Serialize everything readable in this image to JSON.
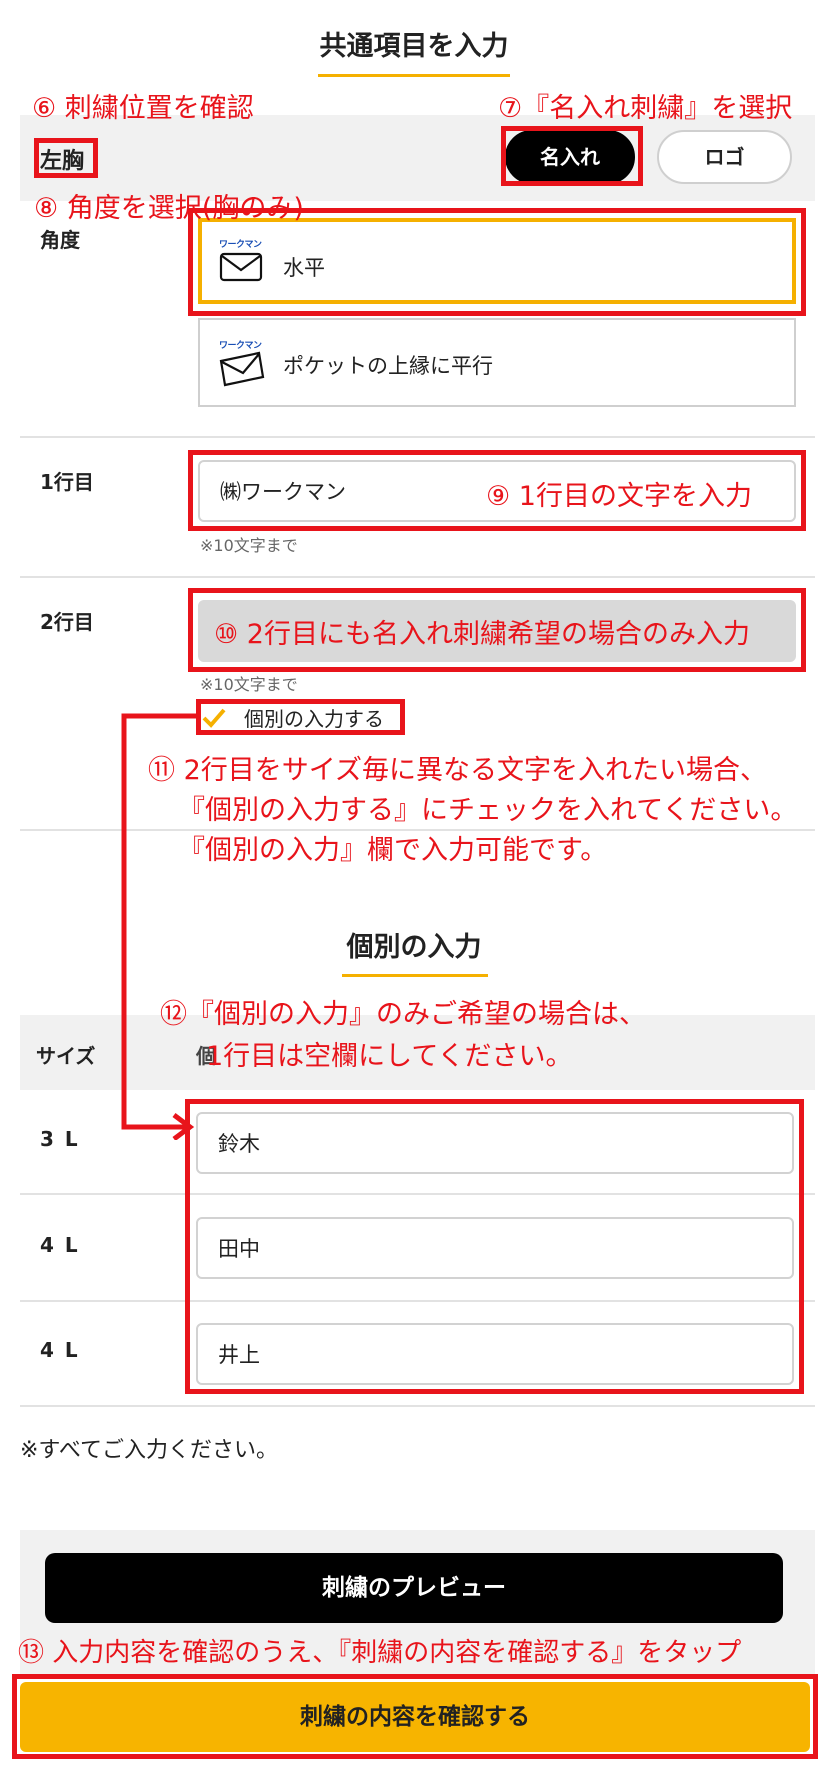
{
  "common": {
    "title": "共通項目を入力",
    "position_label": "左胸",
    "toggle_name": "名入れ",
    "toggle_logo": "ロゴ",
    "angle_label": "角度",
    "angle_options": [
      {
        "label": "水平",
        "icon": "envelope-icon",
        "brand": "ワークマン"
      },
      {
        "label": "ポケットの上縁に平行",
        "icon": "envelope-icon",
        "brand": "ワークマン"
      }
    ],
    "line1_label": "1行目",
    "line1_value": "㈱ワークマン",
    "line1_note": "※10文字まで",
    "line2_label": "2行目",
    "line2_note": "※10文字まで",
    "individual_checkbox_label": "個別の入力する"
  },
  "individual": {
    "title": "個別の入力",
    "header_size": "サイズ",
    "header_name": "個",
    "rows": [
      {
        "size": "3 L",
        "value": "鈴木"
      },
      {
        "size": "4 L",
        "value": "田中"
      },
      {
        "size": "4 L",
        "value": "井上"
      }
    ],
    "note": "※すべてご入力ください。"
  },
  "buttons": {
    "preview": "刺繍のプレビュー",
    "confirm": "刺繍の内容を確認する"
  },
  "annotations": {
    "a6": "⑥ 刺繍位置を確認",
    "a7": "⑦『名入れ刺繍』を選択",
    "a8": "⑧ 角度を選択(胸のみ)",
    "a9": "⑨ 1行目の文字を入力",
    "a10": "⑩ 2行目にも名入れ刺繍希望の場合のみ入力",
    "a11_line1": "⑪ 2行目をサイズ毎に異なる文字を入れたい場合、",
    "a11_line2": "『個別の入力する』にチェックを入れてください。",
    "a11_line3": "『個別の入力』欄で入力可能です。",
    "a12_line1": "⑫『個別の入力』のみご希望の場合は、",
    "a12_line2": "1行目は空欄にしてください。",
    "a13": "⑬ 入力内容を確認のうえ、『刺繍の内容を確認する』をタップ"
  },
  "colors": {
    "accent": "#f5b000",
    "annotation": "#e8141b",
    "brand_blue": "#1a4fb5"
  }
}
